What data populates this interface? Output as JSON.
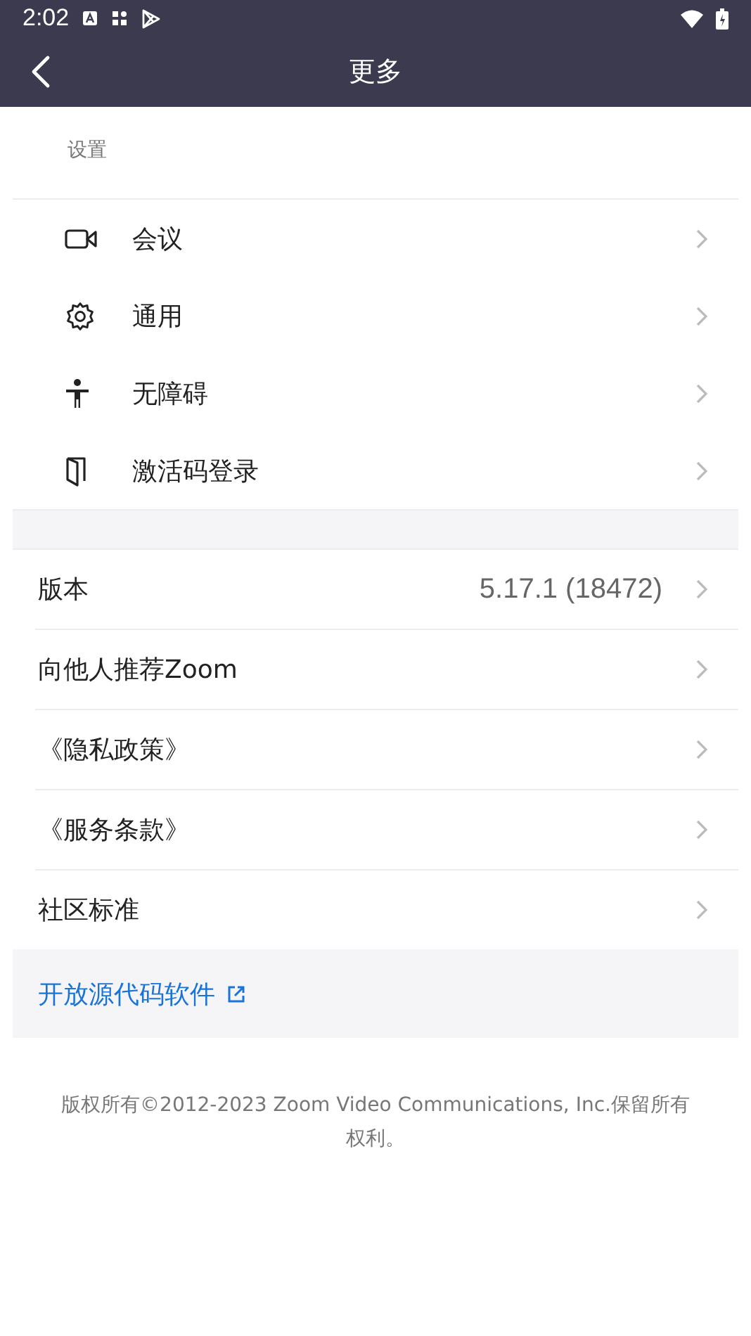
{
  "status_bar": {
    "time": "2:02"
  },
  "header": {
    "title": "更多"
  },
  "settings": {
    "heading": "设置",
    "items": [
      {
        "kind": "video",
        "label": "会议"
      },
      {
        "kind": "gear",
        "label": "通用"
      },
      {
        "kind": "person",
        "label": "无障碍"
      },
      {
        "kind": "door",
        "label": "激活码登录"
      }
    ]
  },
  "info_items": [
    {
      "label": "版本",
      "value": "5.17.1 (18472)"
    },
    {
      "label": "向他人推荐Zoom"
    },
    {
      "label": "《隐私政策》"
    },
    {
      "label": "《服务条款》"
    },
    {
      "label": "社区标准"
    }
  ],
  "open_source_link": "开放源代码软件",
  "footer": "版权所有©2012-2023 Zoom Video Communications, Inc.保留所有权利。"
}
